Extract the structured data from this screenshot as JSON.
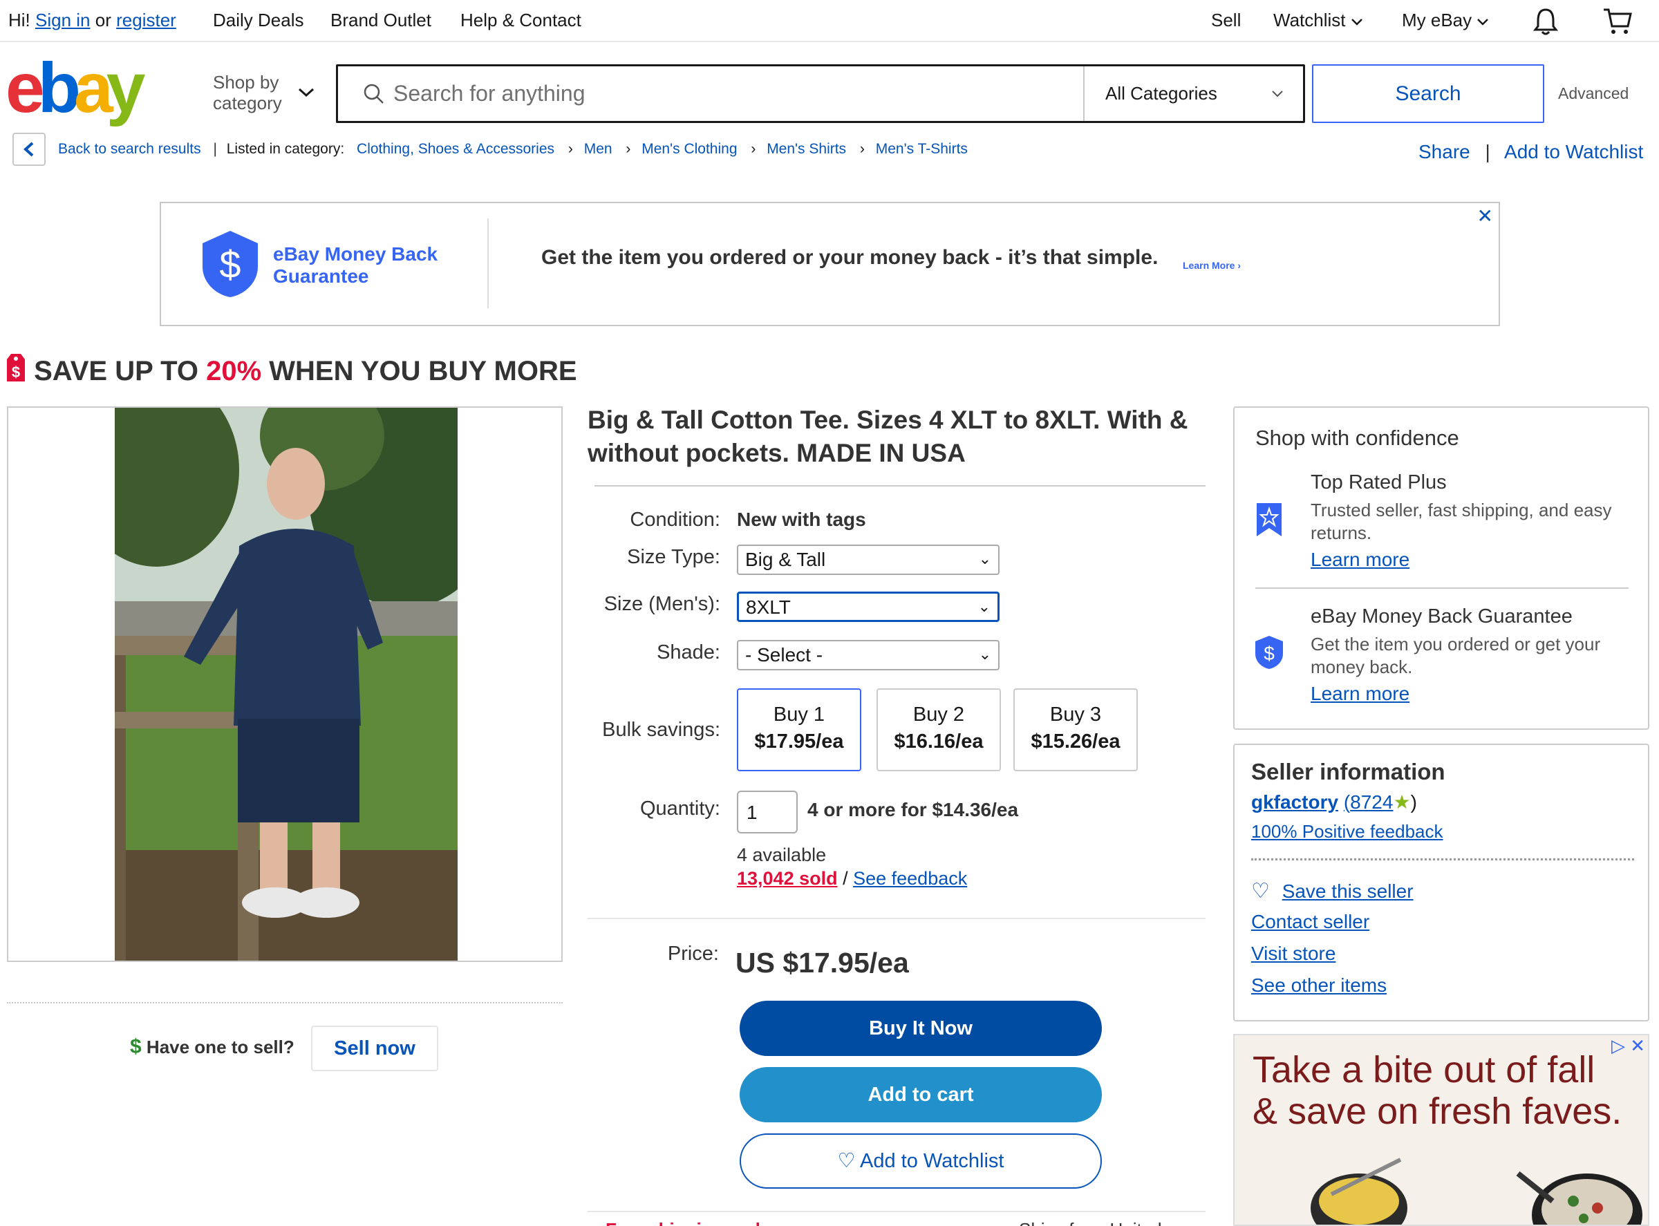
{
  "topbar": {
    "greeting": "Hi!",
    "sign_in": "Sign in",
    "or": "or",
    "register": "register",
    "daily_deals": "Daily Deals",
    "brand_outlet": "Brand Outlet",
    "help_contact": "Help & Contact",
    "sell": "Sell",
    "watchlist": "Watchlist",
    "my_ebay": "My eBay"
  },
  "header": {
    "shop_by_line1": "Shop by",
    "shop_by_line2": "category",
    "search_placeholder": "Search for anything",
    "category_selected": "All Categories",
    "search_button": "Search",
    "advanced": "Advanced"
  },
  "breadcrumb": {
    "back": "Back to search results",
    "listed_in": "Listed in category:",
    "items": [
      "Clothing, Shoes & Accessories",
      "Men",
      "Men's Clothing",
      "Men's Shirts",
      "Men's T-Shirts"
    ],
    "share": "Share",
    "add_watchlist": "Add to Watchlist"
  },
  "banner": {
    "title_line1": "eBay Money Back",
    "title_line2": "Guarantee",
    "text": "Get the item you ordered or your money back - it’s that simple.",
    "learn_more": "Learn More"
  },
  "promo": {
    "prefix": "SAVE UP TO ",
    "percent": "20%",
    "suffix": " WHEN YOU BUY MORE"
  },
  "sell_box": {
    "have_one": "Have one to sell?",
    "sell_now": "Sell now"
  },
  "item": {
    "title": "Big & Tall Cotton Tee. Sizes 4 XLT to 8XLT. With & without pockets. MADE IN USA",
    "condition_label": "Condition:",
    "condition_value": "New with tags",
    "size_type_label": "Size Type:",
    "size_type_value": "Big & Tall",
    "size_label": "Size (Men's):",
    "size_value": "8XLT",
    "shade_label": "Shade:",
    "shade_value": "- Select -",
    "bulk_label": "Bulk savings:",
    "bulk": [
      {
        "qty": "Buy 1",
        "price": "$17.95/ea"
      },
      {
        "qty": "Buy 2",
        "price": "$16.16/ea"
      },
      {
        "qty": "Buy 3",
        "price": "$15.26/ea"
      }
    ],
    "quantity_label": "Quantity:",
    "quantity_value": "1",
    "quantity_note": "4 or more for $14.36/ea",
    "available": "4 available",
    "sold": "13,042 sold",
    "sold_sep": " / ",
    "see_feedback": "See feedback",
    "price_label": "Price:",
    "price": "US $17.95/ea",
    "buy_now": "Buy It Now",
    "add_cart": "Add to cart",
    "add_watchlist": "Add to Watchlist",
    "free_shipping": "Free shipping and",
    "ships_from": "Ships from United"
  },
  "confidence": {
    "title": "Shop with confidence",
    "top_rated_head": "Top Rated Plus",
    "top_rated_body": "Trusted seller, fast shipping, and easy returns.",
    "learn_more_1": "Learn more",
    "mbg_head": "eBay Money Back Guarantee",
    "mbg_body": "Get the item you ordered or get your money back.",
    "learn_more_2": "Learn more"
  },
  "seller": {
    "title": "Seller information",
    "name": "gkfactory",
    "score": "8724",
    "feedback": "100% Positive feedback",
    "save": "Save this seller",
    "contact": "Contact seller",
    "visit": "Visit store",
    "other": "See other items"
  },
  "ad": {
    "line1": "Take a bite out of fall",
    "line2": "& save on fresh faves."
  },
  "colors": {
    "ebay_red": "#e53238",
    "ebay_blue": "#0064d2",
    "ebay_yellow": "#f5af02",
    "ebay_green": "#86b817",
    "link": "#0654ba",
    "buy_now": "#004ca3",
    "add_cart": "#2190cb",
    "promo_red": "#e0103a"
  }
}
